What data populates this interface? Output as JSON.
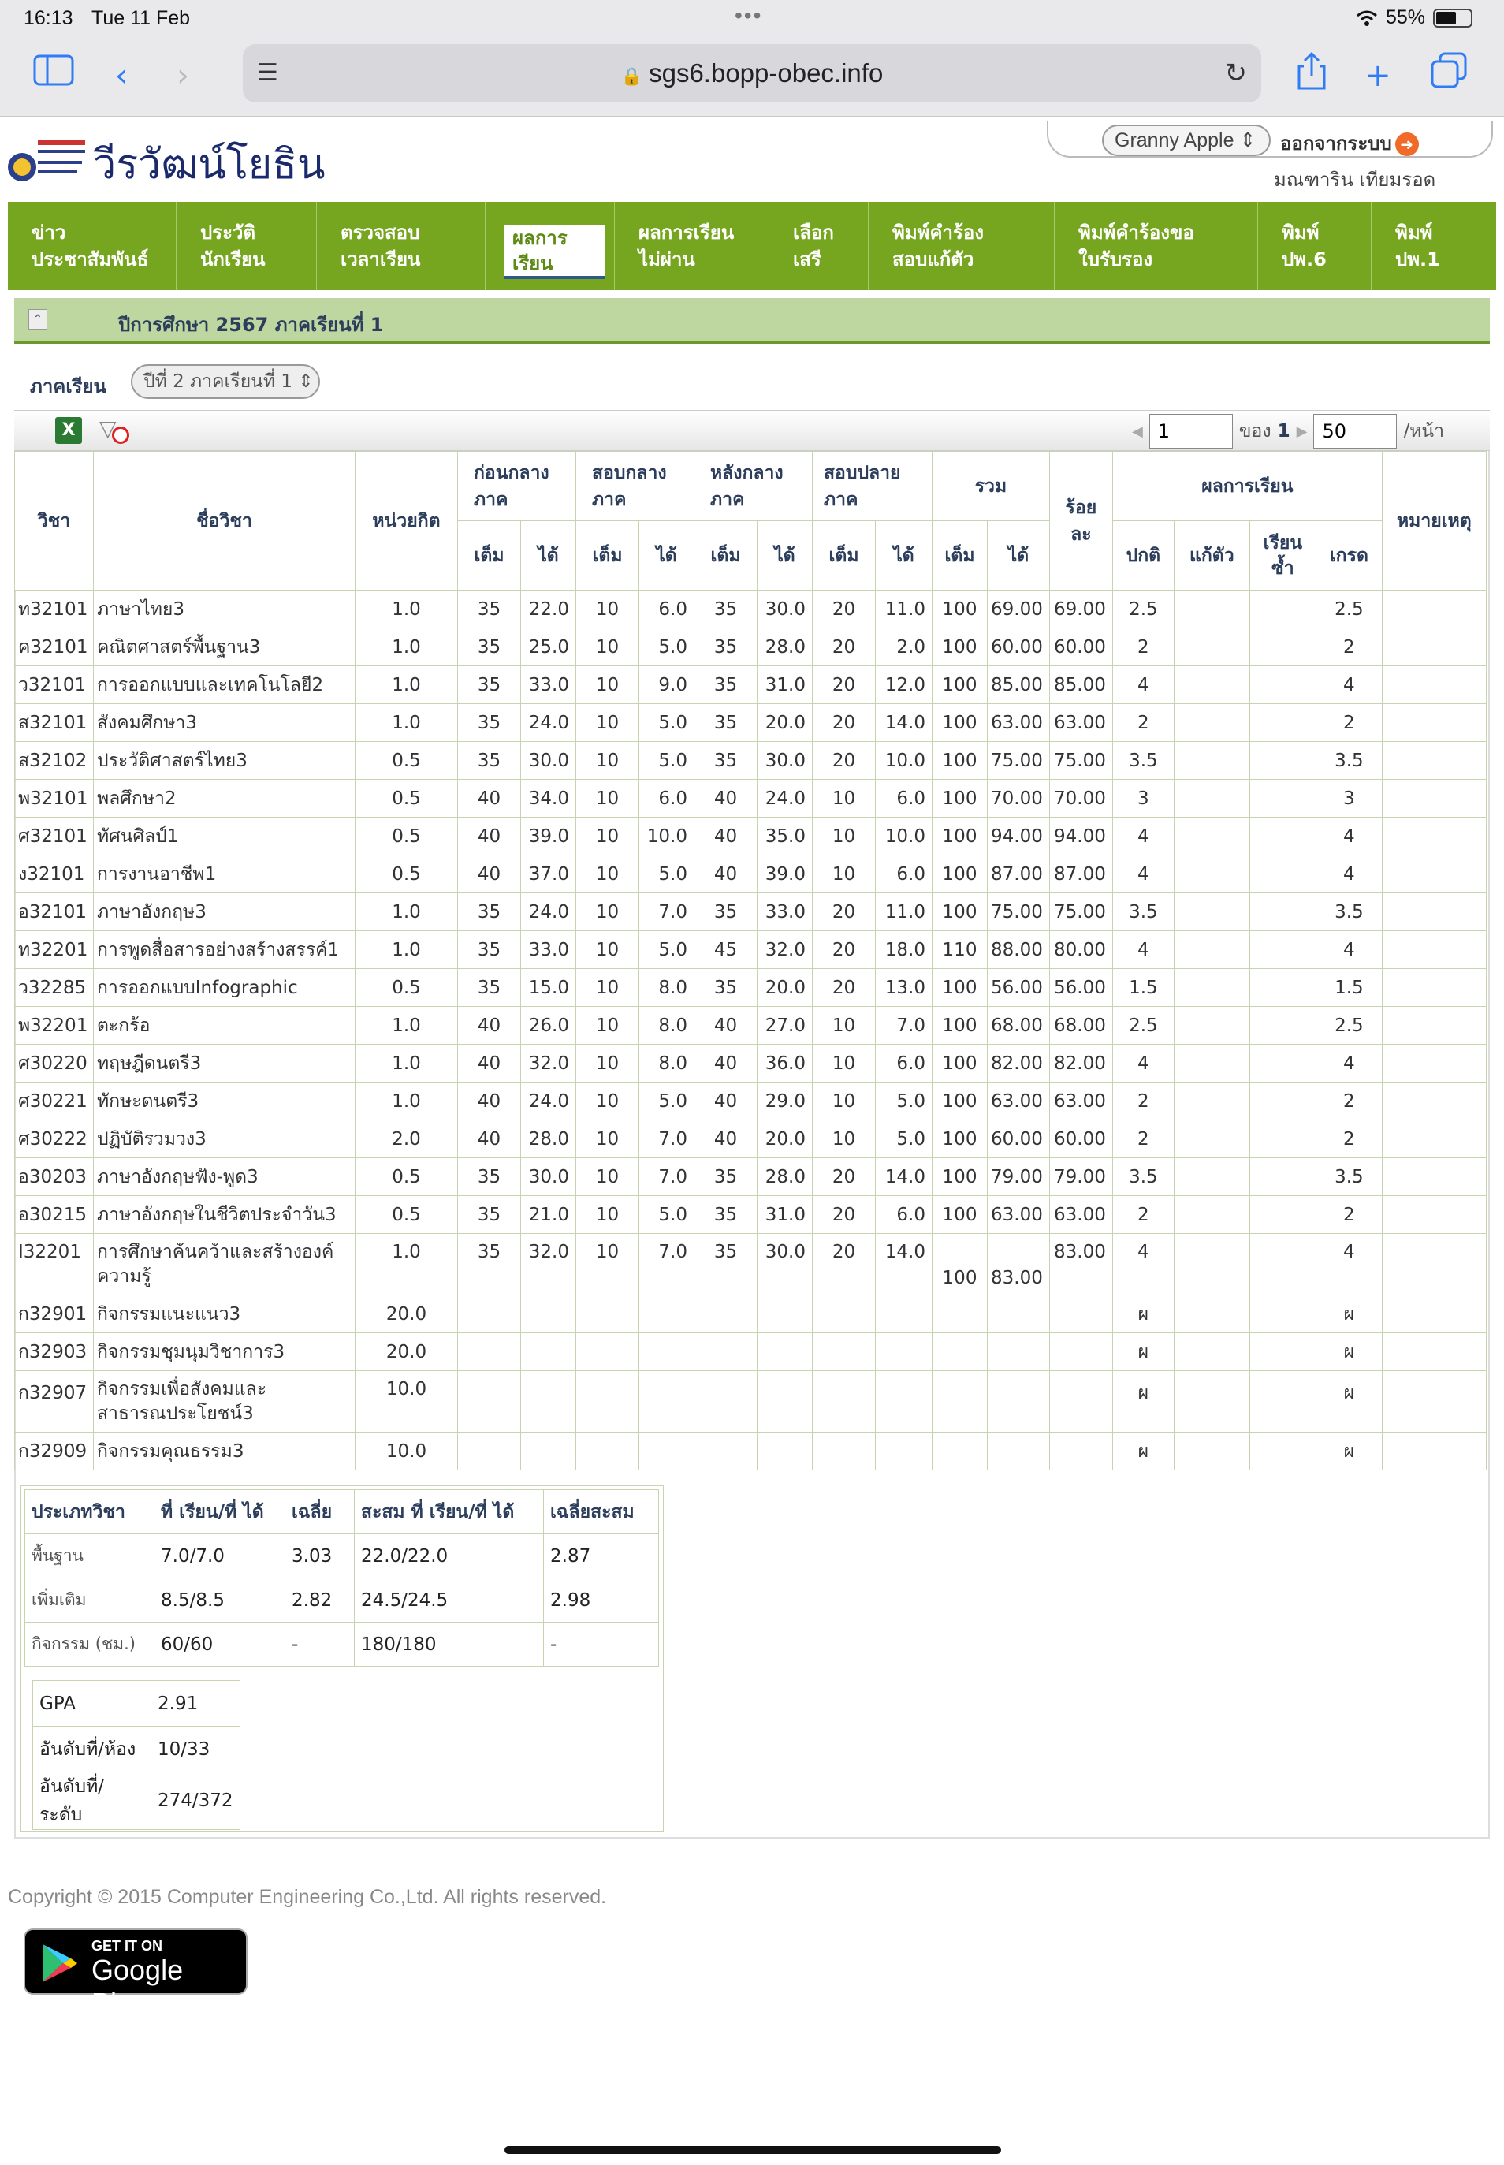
{
  "statusbar": {
    "time": "16:13",
    "date": "Tue 11 Feb",
    "battery": "55%"
  },
  "browser": {
    "url": "sgs6.bopp-obec.info"
  },
  "site": {
    "name": "วีรวัฒน์โยธิน",
    "user_select": "Granny Apple",
    "logout": "ออกจากระบบ",
    "user_name": "มณฑาริน เทียมรอด"
  },
  "nav": [
    {
      "l1": "ข่าว",
      "l2": "ประชาสัมพันธ์"
    },
    {
      "l1": "ประวัติ",
      "l2": "นักเรียน"
    },
    {
      "l1": "ตรวจสอบ",
      "l2": "เวลาเรียน"
    },
    {
      "l1": "ผลการ",
      "l2": "เรียน"
    },
    {
      "l1": "ผลการเรียน",
      "l2": "ไม่ผ่าน"
    },
    {
      "l1": "เลือก",
      "l2": "เสรี"
    },
    {
      "l1": "พิมพ์คำร้อง",
      "l2": "สอบแก้ตัว"
    },
    {
      "l1": "พิมพ์คำร้องขอ",
      "l2": "ใบรับรอง"
    },
    {
      "l1": "พิมพ์",
      "l2": "ปพ.6"
    },
    {
      "l1": "พิมพ์",
      "l2": "ปพ.1"
    }
  ],
  "section": {
    "title": "ปีการศึกษา 2567 ภาคเรียนที่ 1",
    "term_label": "ภาคเรียน",
    "term_value": "ปีที่ 2 ภาคเรียนที่ 1"
  },
  "pager": {
    "page": "1",
    "of_label": "ของ",
    "total": "1",
    "size": "50",
    "per": "/หน้า"
  },
  "table": {
    "h": {
      "code": "วิชา",
      "name": "ชื่อวิชา",
      "credit": "หน่วยกิต",
      "g1": "ก่อนกลาง ภาค",
      "g2": "สอบกลาง ภาค",
      "g3": "หลังกลาง ภาค",
      "g4": "สอบปลาย ภาค",
      "g5": "รวม",
      "pct": "ร้อย ละ",
      "g6": "ผลการเรียน",
      "note": "หมายเหตุ",
      "full": "เต็ม",
      "got": "ได้",
      "normal": "ปกติ",
      "fix": "แก้ตัว",
      "repeat": "เรียน ซ้ำ",
      "grade": "เกรด"
    },
    "rows": [
      [
        "ท32101",
        "ภาษาไทย3",
        "1.0",
        "35",
        "22.0",
        "10",
        "6.0",
        "35",
        "30.0",
        "20",
        "11.0",
        "100",
        "69.00",
        "69.00",
        "2.5",
        "",
        "",
        "2.5",
        ""
      ],
      [
        "ค32101",
        "คณิตศาสตร์พื้นฐาน3",
        "1.0",
        "35",
        "25.0",
        "10",
        "5.0",
        "35",
        "28.0",
        "20",
        "2.0",
        "100",
        "60.00",
        "60.00",
        "2",
        "",
        "",
        "2",
        ""
      ],
      [
        "ว32101",
        "การออกแบบและเทคโนโลยี2",
        "1.0",
        "35",
        "33.0",
        "10",
        "9.0",
        "35",
        "31.0",
        "20",
        "12.0",
        "100",
        "85.00",
        "85.00",
        "4",
        "",
        "",
        "4",
        ""
      ],
      [
        "ส32101",
        "สังคมศึกษา3",
        "1.0",
        "35",
        "24.0",
        "10",
        "5.0",
        "35",
        "20.0",
        "20",
        "14.0",
        "100",
        "63.00",
        "63.00",
        "2",
        "",
        "",
        "2",
        ""
      ],
      [
        "ส32102",
        "ประวัติศาสตร์ไทย3",
        "0.5",
        "35",
        "30.0",
        "10",
        "5.0",
        "35",
        "30.0",
        "20",
        "10.0",
        "100",
        "75.00",
        "75.00",
        "3.5",
        "",
        "",
        "3.5",
        ""
      ],
      [
        "พ32101",
        "พลศึกษา2",
        "0.5",
        "40",
        "34.0",
        "10",
        "6.0",
        "40",
        "24.0",
        "10",
        "6.0",
        "100",
        "70.00",
        "70.00",
        "3",
        "",
        "",
        "3",
        ""
      ],
      [
        "ศ32101",
        "ทัศนศิลป์1",
        "0.5",
        "40",
        "39.0",
        "10",
        "10.0",
        "40",
        "35.0",
        "10",
        "10.0",
        "100",
        "94.00",
        "94.00",
        "4",
        "",
        "",
        "4",
        ""
      ],
      [
        "ง32101",
        "การงานอาชีพ1",
        "0.5",
        "40",
        "37.0",
        "10",
        "5.0",
        "40",
        "39.0",
        "10",
        "6.0",
        "100",
        "87.00",
        "87.00",
        "4",
        "",
        "",
        "4",
        ""
      ],
      [
        "อ32101",
        "ภาษาอังกฤษ3",
        "1.0",
        "35",
        "24.0",
        "10",
        "7.0",
        "35",
        "33.0",
        "20",
        "11.0",
        "100",
        "75.00",
        "75.00",
        "3.5",
        "",
        "",
        "3.5",
        ""
      ],
      [
        "ท32201",
        "การพูดสื่อสารอย่างสร้างสรรค์1",
        "1.0",
        "35",
        "33.0",
        "10",
        "5.0",
        "45",
        "32.0",
        "20",
        "18.0",
        "110",
        "88.00",
        "80.00",
        "4",
        "",
        "",
        "4",
        ""
      ],
      [
        "ว32285",
        "การออกแบบInfographic",
        "0.5",
        "35",
        "15.0",
        "10",
        "8.0",
        "35",
        "20.0",
        "20",
        "13.0",
        "100",
        "56.00",
        "56.00",
        "1.5",
        "",
        "",
        "1.5",
        ""
      ],
      [
        "พ32201",
        "ตะกร้อ",
        "1.0",
        "40",
        "26.0",
        "10",
        "8.0",
        "40",
        "27.0",
        "10",
        "7.0",
        "100",
        "68.00",
        "68.00",
        "2.5",
        "",
        "",
        "2.5",
        ""
      ],
      [
        "ศ30220",
        "ทฤษฎีดนตรี3",
        "1.0",
        "40",
        "32.0",
        "10",
        "8.0",
        "40",
        "36.0",
        "10",
        "6.0",
        "100",
        "82.00",
        "82.00",
        "4",
        "",
        "",
        "4",
        ""
      ],
      [
        "ศ30221",
        "ทักษะดนตรี3",
        "1.0",
        "40",
        "24.0",
        "10",
        "5.0",
        "40",
        "29.0",
        "10",
        "5.0",
        "100",
        "63.00",
        "63.00",
        "2",
        "",
        "",
        "2",
        ""
      ],
      [
        "ศ30222",
        "ปฏิบัติรวมวง3",
        "2.0",
        "40",
        "28.0",
        "10",
        "7.0",
        "40",
        "20.0",
        "10",
        "5.0",
        "100",
        "60.00",
        "60.00",
        "2",
        "",
        "",
        "2",
        ""
      ],
      [
        "อ30203",
        "ภาษาอังกฤษฟัง-พูด3",
        "0.5",
        "35",
        "30.0",
        "10",
        "7.0",
        "35",
        "28.0",
        "20",
        "14.0",
        "100",
        "79.00",
        "79.00",
        "3.5",
        "",
        "",
        "3.5",
        ""
      ],
      [
        "อ30215",
        "ภาษาอังกฤษในชีวิตประจำวัน3",
        "0.5",
        "35",
        "21.0",
        "10",
        "5.0",
        "35",
        "31.0",
        "20",
        "6.0",
        "100",
        "63.00",
        "63.00",
        "2",
        "",
        "",
        "2",
        ""
      ],
      [
        "I32201",
        "การศึกษาค้นคว้าและสร้างองค์ความรู้",
        "1.0",
        "35",
        "32.0",
        "10",
        "7.0",
        "35",
        "30.0",
        "20",
        "14.0",
        "100",
        "83.00",
        "83.00",
        "4",
        "",
        "",
        "4",
        ""
      ],
      [
        "ก32901",
        "กิจกรรมแนะแนว3",
        "20.0",
        "",
        "",
        "",
        "",
        "",
        "",
        "",
        "",
        "",
        "",
        "",
        "ผ",
        "",
        "",
        "ผ",
        ""
      ],
      [
        "ก32903",
        "กิจกรรมชุมนุมวิชาการ3",
        "20.0",
        "",
        "",
        "",
        "",
        "",
        "",
        "",
        "",
        "",
        "",
        "",
        "ผ",
        "",
        "",
        "ผ",
        ""
      ],
      [
        "ก32907",
        "กิจกรรมเพื่อสังคมและสาธารณประโยชน์3",
        "10.0",
        "",
        "",
        "",
        "",
        "",
        "",
        "",
        "",
        "",
        "",
        "",
        "ผ",
        "",
        "",
        "ผ",
        ""
      ],
      [
        "ก32909",
        "กิจกรรมคุณธรรม3",
        "10.0",
        "",
        "",
        "",
        "",
        "",
        "",
        "",
        "",
        "",
        "",
        "",
        "ผ",
        "",
        "",
        "ผ",
        ""
      ]
    ]
  },
  "summary": {
    "headers": [
      "ประเภทวิชา",
      "ที่ เรียน/ที่ ได้",
      "เฉลี่ย",
      "สะสม ที่ เรียน/ที่ ได้",
      "เฉลี่ยสะสม"
    ],
    "rows": [
      [
        "พื้นฐาน",
        "7.0/7.0",
        "3.03",
        "22.0/22.0",
        "2.87"
      ],
      [
        "เพิ่มเติม",
        "8.5/8.5",
        "2.82",
        "24.5/24.5",
        "2.98"
      ],
      [
        "กิจกรรม (ชม.)",
        "60/60",
        "-",
        "180/180",
        "-"
      ]
    ],
    "gpa_label": "GPA",
    "gpa": "2.91",
    "rank_room_label": "อันดับที่/ห้อง",
    "rank_room": "10/33",
    "rank_level_label": "อันดับที่/ระดับ",
    "rank_level": "274/372"
  },
  "footer": {
    "copyright": "Copyright © 2015 Computer Engineering Co.,Ltd. All rights reserved.",
    "gplay_small": "GET IT ON",
    "gplay_big": "Google Play"
  }
}
